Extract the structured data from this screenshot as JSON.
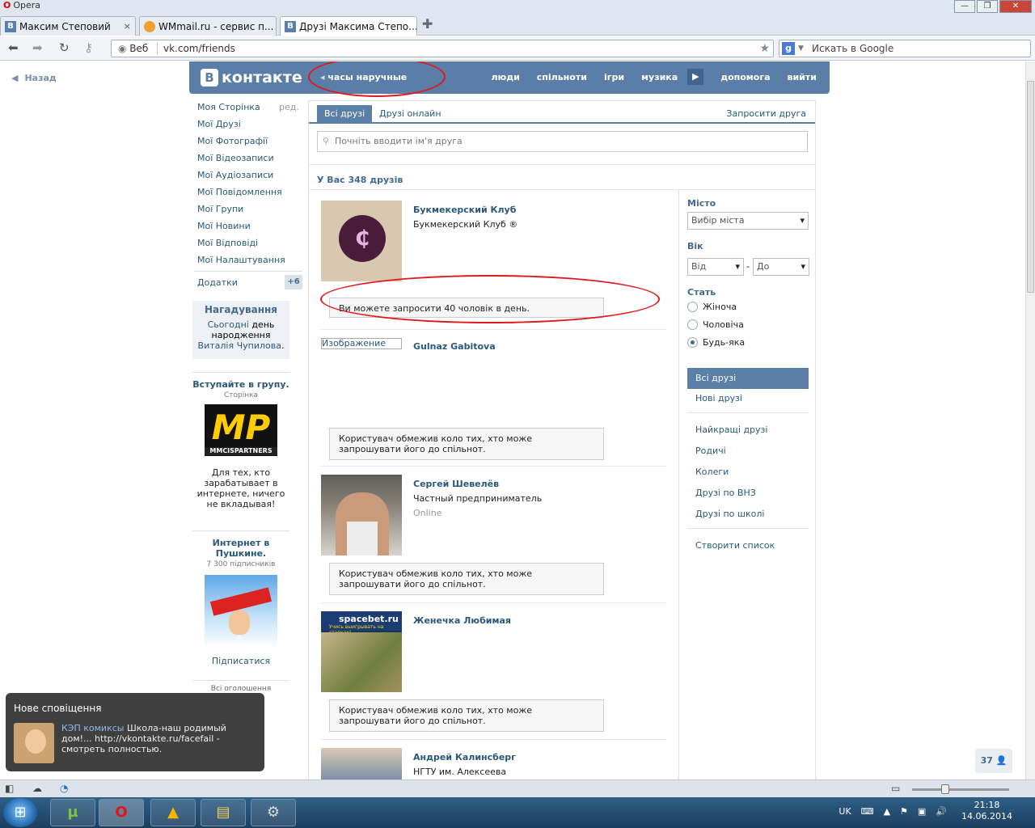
{
  "browser": {
    "app_name": "Opera",
    "tabs": [
      {
        "label": "Максим Степовий",
        "icon": "vk-favicon"
      },
      {
        "label": "WMmail.ru - сервис п...",
        "icon": "wmmail-favicon"
      },
      {
        "label": "Друзі Максима Степо...",
        "icon": "vk-favicon"
      }
    ],
    "address_web_label": "Веб",
    "url": "vk.com/friends",
    "search_placeholder": "Искать в Google"
  },
  "vk": {
    "back": "Назад",
    "logo_text": "контакте",
    "logo_letter": "В",
    "header_query": "часы наручные",
    "nav": [
      "люди",
      "спільноти",
      "ігри",
      "музика"
    ],
    "nav2": [
      "допомога",
      "вийти"
    ],
    "left_menu": [
      "Моя Сторінка",
      "Мої Друзі",
      "Мої Фотографії",
      "Мої Відеозаписи",
      "Мої Аудіозаписи",
      "Мої Повідомлення",
      "Мої Групи",
      "Мої Новини",
      "Мої Відповіді",
      "Мої Налаштування"
    ],
    "edit": "ред.",
    "addons": "Додатки",
    "addons_count": "+6",
    "reminder": {
      "title": "Нагадування",
      "text1": "Сьогодні",
      "text2": " день народження ",
      "name": "Виталія Чупилова",
      "dot": "."
    },
    "promo1": {
      "title": "Вступайте в групу.",
      "sub": "Сторінка",
      "logo": "MP",
      "logo_sub": "MMCISPARTNERS",
      "text": "Для тех, кто зарабатывает в интернете, ничего не вкладывая!"
    },
    "promo2": {
      "title": "Интернет в Пушкине.",
      "sub": "7 300 підписників",
      "action": "Підписатися"
    },
    "all_ads": "Всі оголошення",
    "tabs": {
      "all": "Всі друзі",
      "online": "Друзі онлайн",
      "invite": "Запросити друга"
    },
    "search_placeholder": "Почніть вводити ім'я друга",
    "friends_count": "У Вас 348 друзів",
    "friends": [
      {
        "name": "Букмекерский Клуб",
        "desc": "Букмекерский Клуб ®",
        "note": "Ви можете запросити 40 чоловік в день."
      },
      {
        "name": "Gulnaz Gabitova",
        "photo_alt": "Изображение",
        "note": "Користувач обмежив коло тих, хто може запрошувати його до спільнот."
      },
      {
        "name": "Сергей Шевелёв",
        "desc": "Частный предприниматель",
        "status": "Online",
        "note": "Користувач обмежив коло тих, хто може запрошувати його до спільнот."
      },
      {
        "name": "Женечка Любимая",
        "photo_brand": "spacebet.ru",
        "photo_slogan": "Учись выигрывать на ставках!",
        "note": "Користувач обмежив коло тих, хто може запрошувати його до спільнот."
      },
      {
        "name": "Андрей Калинсберг",
        "desc": "НГТУ им. Алексеева"
      }
    ],
    "filters": {
      "city_label": "Місто",
      "city_placeholder": "Вибір міста",
      "age_label": "Вік",
      "age_from": "Від",
      "age_dash": "-",
      "age_to": "До",
      "sex_label": "Стать",
      "sex_options": [
        "Жіноча",
        "Чоловіча",
        "Будь-яка"
      ],
      "sex_selected": "Будь-яка"
    },
    "lists": {
      "all": "Всі друзі",
      "new": "Нові друзі",
      "items": [
        "Найкращі друзі",
        "Родичі",
        "Колеги",
        "Друзі по ВНЗ",
        "Друзі по школі"
      ],
      "create": "Створити список"
    },
    "online_badge": "37"
  },
  "notification": {
    "title": "Нове сповіщення",
    "source": "КЭП комиксы",
    "text": " Школа-наш родимый дом!... http://vkontakte.ru/facefail - смотреть полностью."
  },
  "taskbar": {
    "lang": "UK",
    "time": "21:18",
    "date": "14.06.2014"
  },
  "colors": {
    "vk_blue": "#5a7ea8",
    "link": "#2b587a",
    "annotation_red": "#e0191c"
  }
}
